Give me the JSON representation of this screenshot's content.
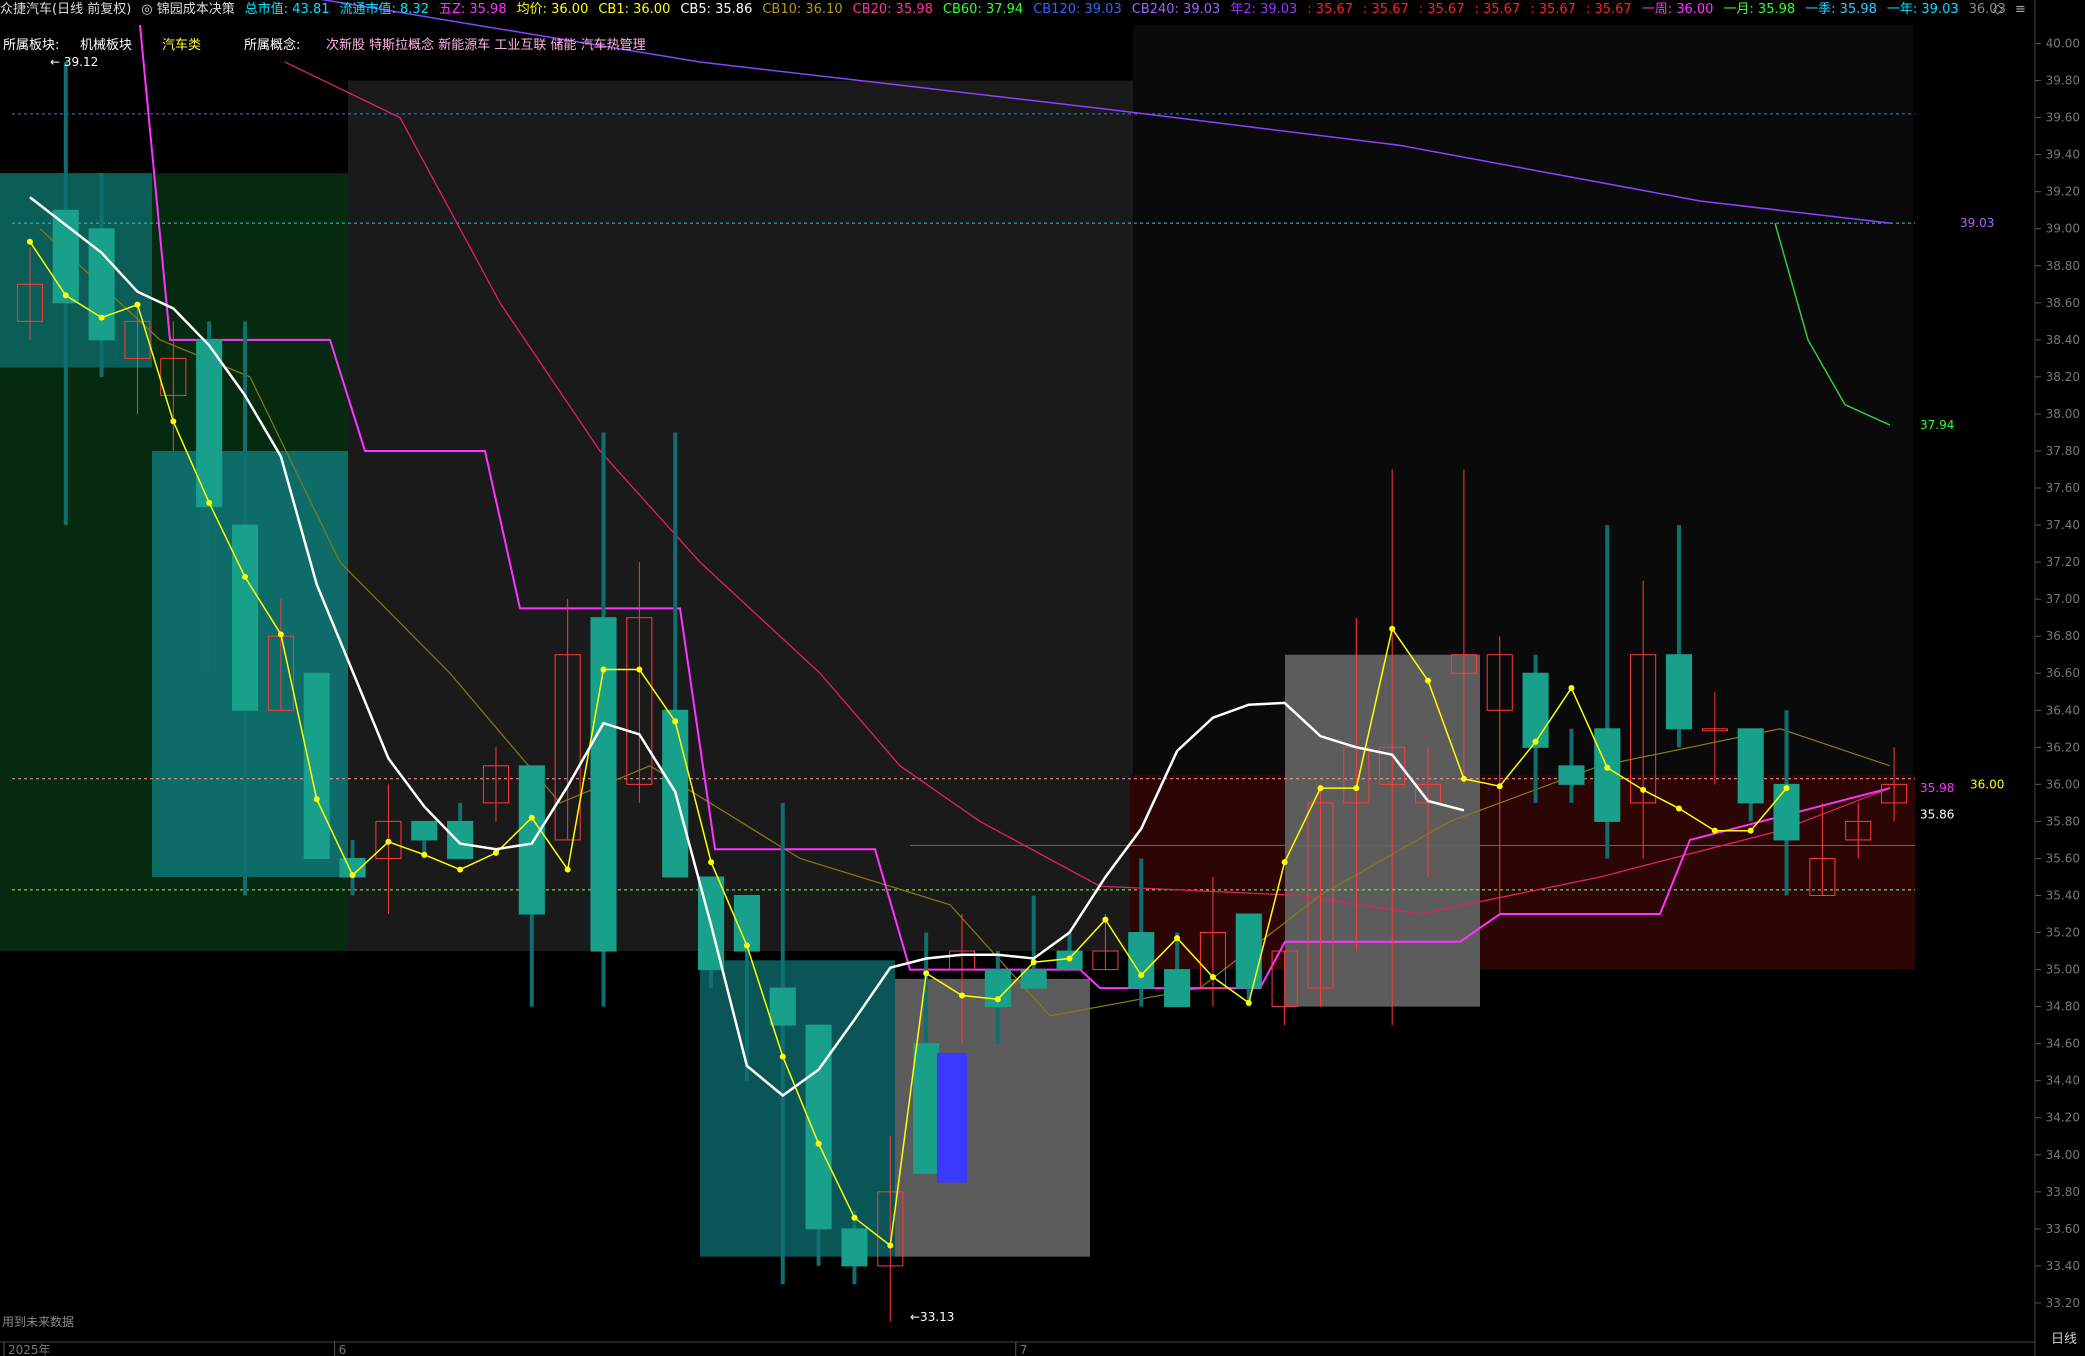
{
  "info_bar": [
    {
      "text": "众捷汽车(日线 前复权)",
      "color": "#dddddd"
    },
    {
      "text": "◎ 锦园成本决策",
      "color": "#dddddd"
    },
    {
      "text": "总市值: 43.81",
      "color": "#00e5ff"
    },
    {
      "text": "流通市值: 8.32",
      "color": "#00e5ff"
    },
    {
      "text": "五Z: 35.98",
      "color": "#ff33ff"
    },
    {
      "text": "均价: 36.00",
      "color": "#ffff00"
    },
    {
      "text": "CB1: 36.00",
      "color": "#ffff00"
    },
    {
      "text": "CB5: 35.86",
      "color": "#ffffff"
    },
    {
      "text": "CB10: 36.10",
      "color": "#b59a12"
    },
    {
      "text": "CB20: 35.98",
      "color": "#ff3399"
    },
    {
      "text": "CB60: 37.94",
      "color": "#33ff33"
    },
    {
      "text": "CB120: 39.03",
      "color": "#3366ff"
    },
    {
      "text": "CB240: 39.03",
      "color": "#9966ff"
    },
    {
      "text": "年2: 39.03",
      "color": "#9933ff"
    },
    {
      "text": ": 35.67",
      "color": "#ff2020"
    },
    {
      "text": ": 35.67",
      "color": "#ff2020"
    },
    {
      "text": ": 35.67",
      "color": "#ff2020"
    },
    {
      "text": ": 35.67",
      "color": "#ff2020"
    },
    {
      "text": ": 35.67",
      "color": "#ff2020"
    },
    {
      "text": ": 35.67",
      "color": "#ff2020"
    },
    {
      "text": "一周: 36.00",
      "color": "#ff33ff"
    },
    {
      "text": "一月: 35.98",
      "color": "#33ff33"
    },
    {
      "text": "一季: 35.98",
      "color": "#33ccff"
    },
    {
      "text": "一年: 39.03",
      "color": "#00e5ff"
    },
    {
      "text": "36.03",
      "color": "#888888"
    }
  ],
  "block_bar": {
    "sector_label": "所属板块:",
    "sector_value": "机械板块",
    "industry_label": "汽车类",
    "concept_label": "所属概念:",
    "concepts": "次新股 特斯拉概念 新能源车 工业互联 储能 汽车热管理"
  },
  "future_note": "用到未来数据",
  "period_label": "日线",
  "top_icons": [
    "◇",
    "≡"
  ],
  "chart_data": {
    "type": "candlestick",
    "ylim": [
      33.0,
      40.1
    ],
    "y_ticks": [
      33.2,
      33.4,
      33.6,
      33.8,
      34.0,
      34.2,
      34.4,
      34.6,
      34.8,
      35.0,
      35.2,
      35.4,
      35.6,
      35.8,
      36.0,
      36.2,
      36.4,
      36.6,
      36.8,
      37.0,
      37.2,
      37.4,
      37.6,
      37.8,
      38.0,
      38.2,
      38.4,
      38.6,
      38.8,
      39.0,
      39.2,
      39.4,
      39.6,
      39.8,
      40.0
    ],
    "x_labels": [
      {
        "label": "2025年",
        "index": 0
      },
      {
        "label": "6",
        "index": 9
      },
      {
        "label": "7",
        "index": 28
      }
    ],
    "candles": [
      {
        "o": 38.5,
        "c": 38.7,
        "h": 38.9,
        "l": 38.4,
        "up": true
      },
      {
        "o": 39.1,
        "c": 38.6,
        "h": 39.9,
        "l": 37.4,
        "up": false
      },
      {
        "o": 39.0,
        "c": 38.4,
        "h": 39.3,
        "l": 38.2,
        "up": false
      },
      {
        "o": 38.3,
        "c": 38.5,
        "h": 38.6,
        "l": 38.0,
        "up": true
      },
      {
        "o": 38.1,
        "c": 38.3,
        "h": 38.5,
        "l": 37.8,
        "up": true
      },
      {
        "o": 38.4,
        "c": 37.5,
        "h": 38.5,
        "l": 36.6,
        "up": false
      },
      {
        "o": 37.4,
        "c": 36.4,
        "h": 38.5,
        "l": 35.4,
        "up": false
      },
      {
        "o": 36.4,
        "c": 36.8,
        "h": 37.0,
        "l": 36.4,
        "up": true
      },
      {
        "o": 36.6,
        "c": 35.6,
        "h": 36.6,
        "l": 35.6,
        "up": false
      },
      {
        "o": 35.6,
        "c": 35.5,
        "h": 35.7,
        "l": 35.4,
        "up": false
      },
      {
        "o": 35.6,
        "c": 35.8,
        "h": 36.0,
        "l": 35.3,
        "up": true
      },
      {
        "o": 35.8,
        "c": 35.7,
        "h": 35.8,
        "l": 35.6,
        "up": false
      },
      {
        "o": 35.8,
        "c": 35.6,
        "h": 35.9,
        "l": 35.6,
        "up": false
      },
      {
        "o": 35.9,
        "c": 36.1,
        "h": 36.2,
        "l": 35.8,
        "up": true
      },
      {
        "o": 36.1,
        "c": 35.3,
        "h": 36.1,
        "l": 34.8,
        "up": false
      },
      {
        "o": 35.7,
        "c": 36.7,
        "h": 37.0,
        "l": 35.7,
        "up": true
      },
      {
        "o": 36.9,
        "c": 35.1,
        "h": 37.9,
        "l": 34.8,
        "up": false
      },
      {
        "o": 36.0,
        "c": 36.9,
        "h": 37.2,
        "l": 35.9,
        "up": true
      },
      {
        "o": 36.4,
        "c": 35.5,
        "h": 37.9,
        "l": 35.5,
        "up": false
      },
      {
        "o": 35.5,
        "c": 35.0,
        "h": 35.5,
        "l": 34.9,
        "up": false
      },
      {
        "o": 35.4,
        "c": 35.1,
        "h": 35.4,
        "l": 34.4,
        "up": false
      },
      {
        "o": 34.9,
        "c": 34.7,
        "h": 35.9,
        "l": 33.3,
        "up": false
      },
      {
        "o": 34.7,
        "c": 33.6,
        "h": 34.7,
        "l": 33.4,
        "up": false
      },
      {
        "o": 33.6,
        "c": 33.4,
        "h": 33.7,
        "l": 33.3,
        "up": false
      },
      {
        "o": 33.4,
        "c": 33.8,
        "h": 34.1,
        "l": 33.1,
        "up": true
      },
      {
        "o": 34.6,
        "c": 33.9,
        "h": 35.2,
        "l": 33.9,
        "up": false
      },
      {
        "o": 35.0,
        "c": 35.1,
        "h": 35.3,
        "l": 34.6,
        "up": true
      },
      {
        "o": 35.0,
        "c": 34.8,
        "h": 35.1,
        "l": 34.6,
        "up": false
      },
      {
        "o": 35.0,
        "c": 34.9,
        "h": 35.4,
        "l": 34.9,
        "up": false
      },
      {
        "o": 35.1,
        "c": 35.0,
        "h": 35.2,
        "l": 35.0,
        "up": false
      },
      {
        "o": 35.0,
        "c": 35.1,
        "h": 35.3,
        "l": 35.0,
        "up": true
      },
      {
        "o": 35.2,
        "c": 34.9,
        "h": 35.6,
        "l": 34.8,
        "up": false
      },
      {
        "o": 35.0,
        "c": 34.8,
        "h": 35.2,
        "l": 34.8,
        "up": false
      },
      {
        "o": 34.9,
        "c": 35.2,
        "h": 35.5,
        "l": 34.8,
        "up": true
      },
      {
        "o": 35.3,
        "c": 34.9,
        "h": 35.3,
        "l": 34.8,
        "up": false
      },
      {
        "o": 34.8,
        "c": 35.1,
        "h": 35.1,
        "l": 34.7,
        "up": true
      },
      {
        "o": 34.9,
        "c": 35.9,
        "h": 36.0,
        "l": 34.8,
        "up": true
      },
      {
        "o": 35.9,
        "c": 36.2,
        "h": 36.9,
        "l": 35.1,
        "up": true
      },
      {
        "o": 36.0,
        "c": 36.2,
        "h": 37.7,
        "l": 34.7,
        "up": true
      },
      {
        "o": 35.9,
        "c": 36.0,
        "h": 36.2,
        "l": 35.5,
        "up": true
      },
      {
        "o": 36.6,
        "c": 36.7,
        "h": 37.7,
        "l": 36.0,
        "up": true
      },
      {
        "o": 36.4,
        "c": 36.7,
        "h": 36.8,
        "l": 35.3,
        "up": true
      },
      {
        "o": 36.6,
        "c": 36.2,
        "h": 36.7,
        "l": 35.9,
        "up": false
      },
      {
        "o": 36.1,
        "c": 36.0,
        "h": 36.3,
        "l": 35.9,
        "up": false
      },
      {
        "o": 36.3,
        "c": 35.8,
        "h": 37.4,
        "l": 35.6,
        "up": false
      },
      {
        "o": 35.9,
        "c": 36.7,
        "h": 37.1,
        "l": 35.6,
        "up": true
      },
      {
        "o": 36.7,
        "c": 36.3,
        "h": 37.4,
        "l": 36.2,
        "up": false
      },
      {
        "o": 36.3,
        "c": 36.3,
        "h": 36.5,
        "l": 36.0,
        "up": true
      },
      {
        "o": 36.3,
        "c": 35.9,
        "h": 36.3,
        "l": 35.8,
        "up": false
      },
      {
        "o": 36.0,
        "c": 35.7,
        "h": 36.4,
        "l": 35.4,
        "up": false
      },
      {
        "o": 35.6,
        "c": 35.4,
        "h": 35.9,
        "l": 35.4,
        "up": true
      },
      {
        "o": 35.7,
        "c": 35.8,
        "h": 35.9,
        "l": 35.6,
        "up": true
      },
      {
        "o": 35.9,
        "c": 36.0,
        "h": 36.2,
        "l": 35.8,
        "up": true
      }
    ],
    "series": [
      {
        "type": "line",
        "color": "#ffff00",
        "width": 1.5,
        "markers": true,
        "values": [
          38.93,
          38.64,
          38.52,
          38.59,
          37.96,
          37.52,
          37.12,
          36.81,
          35.92,
          35.51,
          35.69,
          35.62,
          35.54,
          35.63,
          35.82,
          35.54,
          36.62,
          36.62,
          36.34,
          35.58,
          35.13,
          34.53,
          34.06,
          33.66,
          33.51,
          34.98,
          34.86,
          34.84,
          35.04,
          35.06,
          35.27,
          34.97,
          35.17,
          34.96,
          34.82,
          35.58,
          35.98,
          35.98,
          36.84,
          36.56,
          36.03,
          35.99,
          36.23,
          36.52,
          36.09,
          35.97,
          35.87,
          35.75,
          35.75,
          35.98
        ]
      },
      {
        "type": "line",
        "color": "#ffffff",
        "width": 2.5,
        "markers": false,
        "values": [
          39.17,
          39.02,
          38.87,
          38.66,
          38.57,
          38.37,
          38.1,
          37.77,
          37.08,
          36.61,
          36.14,
          35.88,
          35.68,
          35.65,
          35.68,
          35.99,
          36.33,
          36.27,
          35.96,
          35.24,
          34.48,
          34.32,
          34.46,
          34.73,
          35.01,
          35.06,
          35.08,
          35.08,
          35.06,
          35.2,
          35.5,
          35.76,
          36.18,
          36.36,
          36.43,
          36.44,
          36.26,
          36.2,
          36.16,
          35.91,
          35.86
        ]
      }
    ],
    "labels": {
      "max_label": "39.12",
      "min_label": "33.13",
      "cb5_label": "35.86",
      "cb1_label": "36.00",
      "cb20_label": "35.98",
      "cb60_label": "37.94",
      "cb240_label": "39.03"
    }
  }
}
